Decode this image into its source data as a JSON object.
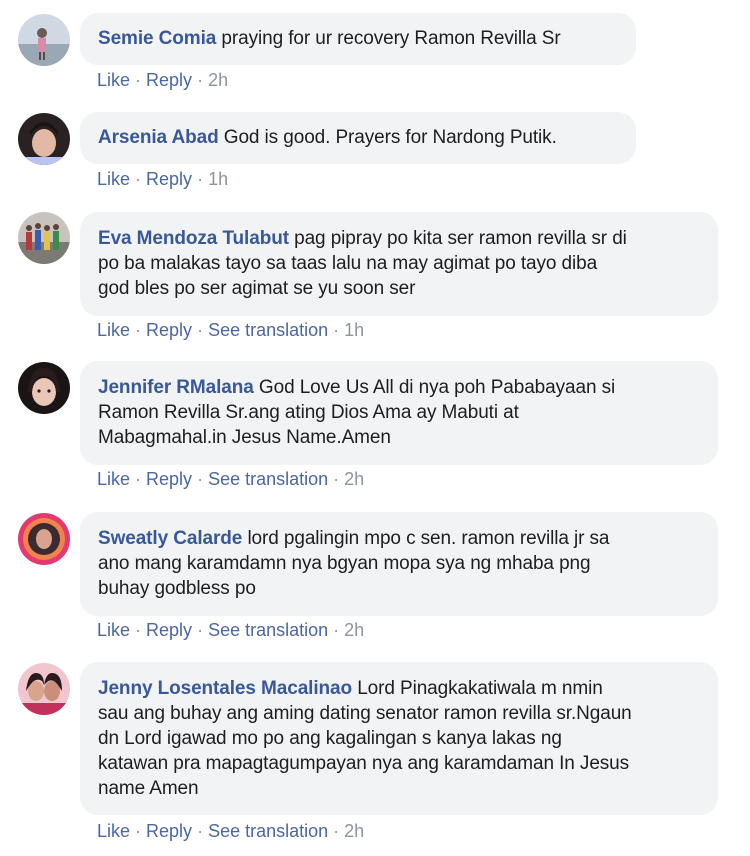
{
  "action_labels": {
    "like": "Like",
    "reply": "Reply",
    "translate": "See translation",
    "separator": "·"
  },
  "comments": [
    {
      "author": "Semie Comia",
      "text": "praying for ur recovery Ramon Revilla Sr",
      "time": "2h",
      "has_translation": false
    },
    {
      "author": "Arsenia Abad",
      "text": "God is good. Prayers for Nardong Putik.",
      "time": "1h",
      "has_translation": false
    },
    {
      "author": "Eva Mendoza Tulabut",
      "lines": [
        "pag pipray po kita ser ramon revilla sr di",
        "po ba malakas tayo sa taas lalu na may agimat po tayo diba",
        "god bles po ser agimat se yu soon ser"
      ],
      "time": "1h",
      "has_translation": true
    },
    {
      "author": "Jennifer RMalana",
      "lines": [
        "God Love Us All di nya poh Pababayaan si",
        "Ramon Revilla Sr.ang ating Dios Ama ay Mabuti at",
        "Mabagmahal.in Jesus Name.Amen"
      ],
      "time": "2h",
      "has_translation": true
    },
    {
      "author": "Sweatly Calarde",
      "lines": [
        "lord pgalingin mpo c sen. ramon revilla jr sa",
        "ano mang karamdamn nya bgyan mopa sya ng mhaba png",
        "buhay godbless po"
      ],
      "time": "2h",
      "has_translation": true
    },
    {
      "author": "Jenny Losentales Macalinao",
      "lines": [
        "Lord Pinagkakatiwala m nmin",
        "sau ang buhay ang aming dating senator ramon revilla sr.Ngaun",
        "dn Lord igawad mo po ang kagalingan s kanya lakas ng",
        "katawan pra mapagtagumpayan nya ang karamdaman In Jesus",
        "name Amen"
      ],
      "time": "2h",
      "has_translation": true
    }
  ]
}
